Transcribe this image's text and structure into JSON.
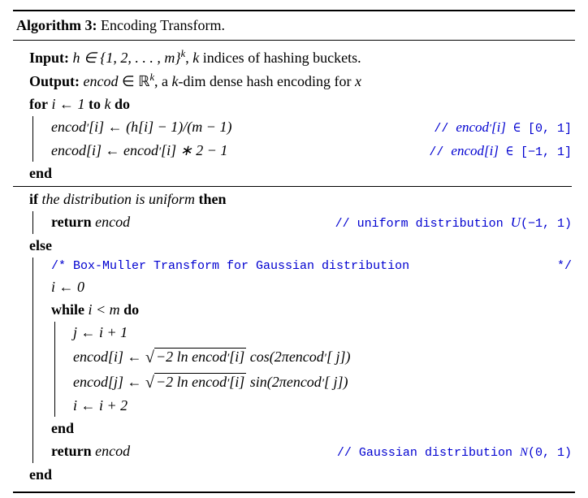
{
  "header": {
    "label": "Algorithm 3:",
    "title": "Encoding Transform."
  },
  "io": {
    "input_label": "Input:",
    "input_text_1": "h ∈ {1, 2, . . . , m}",
    "input_sup": "k",
    "input_text_2": ", k indices of hashing buckets.",
    "output_label": "Output:",
    "output_text_1": "encod ∈ ℝ",
    "output_sup": "k",
    "output_text_2": ", a k-dim dense hash encoding for x"
  },
  "for": {
    "kw1": "for",
    "var": "i ← 1",
    "kw2": "to",
    "lim": "k",
    "kw3": "do",
    "line1_left": "encod′[i] ← (h[i] − 1)/(m − 1)",
    "line1_right": "// encod′[i] ∈ [0, 1]",
    "line2_left": "encod[i] ← encod′[i] ∗ 2 − 1",
    "line2_right": "// encod[i] ∈ [−1, 1]",
    "end": "end"
  },
  "ifblock": {
    "kw_if": "if",
    "cond": "the distribution is uniform",
    "kw_then": "then",
    "ret": "return",
    "ret_var": "encod",
    "ret_comment": "// uniform distribution U(−1, 1)",
    "kw_else": "else",
    "box_comment_l": "/* Box-Muller Transform for Gaussian distribution",
    "box_comment_r": "*/",
    "init": "i ← 0",
    "kw_while": "while",
    "while_cond": "i < m",
    "kw_do": "do",
    "w1": "j ← i + 1",
    "w2_pre": "encod[i] ← ",
    "w2_sqrt": "−2 ln encod′[i]",
    "w2_post": " cos(2πencod′[j])",
    "w3_pre": "encod[j] ← ",
    "w3_sqrt": "−2 ln encod′[i]",
    "w3_post": " sin(2πencod′[j])",
    "w4": "i ← i + 2",
    "end_while": "end",
    "ret2": "return",
    "ret2_var": "encod",
    "ret2_comment_pre": "// Gaussian distribution ",
    "ret2_comment_n": "N",
    "ret2_comment_post": "(0, 1)",
    "end_if": "end"
  }
}
